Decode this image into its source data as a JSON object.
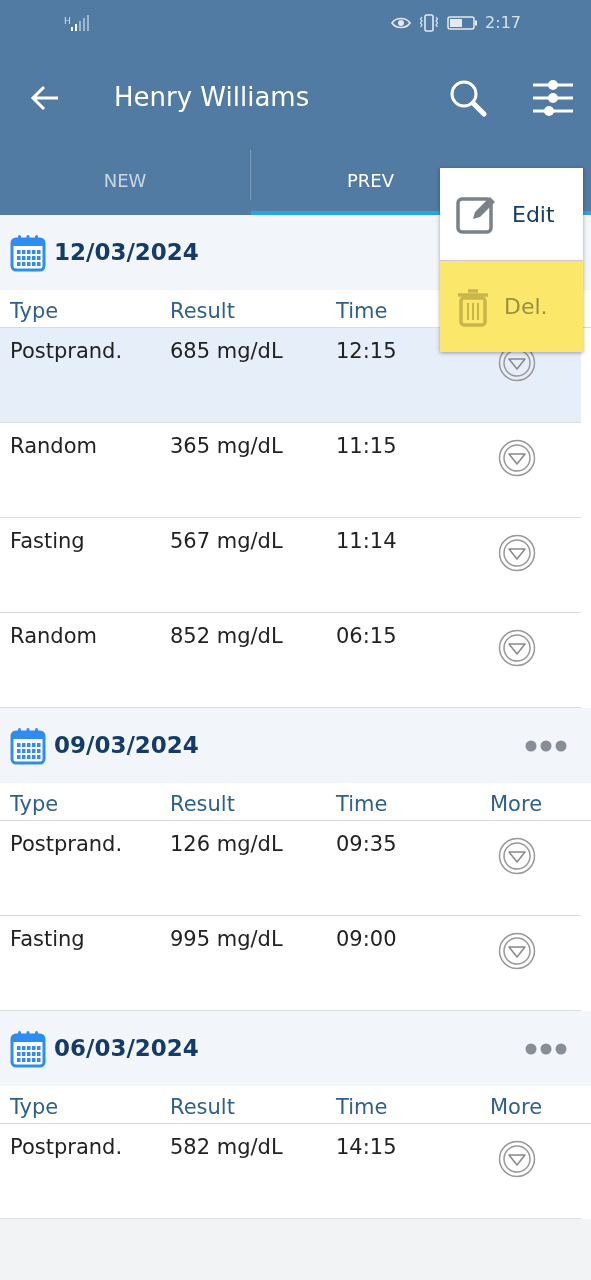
{
  "status_bar": {
    "network": "H",
    "time": "2:17"
  },
  "app_bar": {
    "title": "Henry Williams"
  },
  "tabs": [
    {
      "label": "NEW",
      "selected": false
    },
    {
      "label": "PREV",
      "selected": true
    }
  ],
  "groups": [
    {
      "date": "12/03/2024",
      "columns": [
        "Type",
        "Result",
        "Time"
      ],
      "show_more_menu": false,
      "rows": [
        {
          "type": "Postprand.",
          "result": "685 mg/dL",
          "time": "12:15",
          "selected": true
        },
        {
          "type": "Random",
          "result": "365 mg/dL",
          "time": "11:15",
          "selected": false
        },
        {
          "type": "Fasting",
          "result": "567 mg/dL",
          "time": "11:14",
          "selected": false
        },
        {
          "type": "Random",
          "result": "852 mg/dL",
          "time": "06:15",
          "selected": false
        }
      ]
    },
    {
      "date": "09/03/2024",
      "columns": [
        "Type",
        "Result",
        "Time",
        "More"
      ],
      "show_more_menu": true,
      "rows": [
        {
          "type": "Postprand.",
          "result": "126 mg/dL",
          "time": "09:35",
          "selected": false
        },
        {
          "type": "Fasting",
          "result": "995 mg/dL",
          "time": "09:00",
          "selected": false
        }
      ]
    },
    {
      "date": "06/03/2024",
      "columns": [
        "Type",
        "Result",
        "Time",
        "More"
      ],
      "show_more_menu": true,
      "rows": [
        {
          "type": "Postprand.",
          "result": "582 mg/dL",
          "time": "14:15",
          "selected": false
        }
      ]
    }
  ],
  "popup_menu": [
    {
      "kind": "edit",
      "label": "Edit",
      "selected": false
    },
    {
      "kind": "delete",
      "label": "Del.",
      "selected": true
    }
  ]
}
